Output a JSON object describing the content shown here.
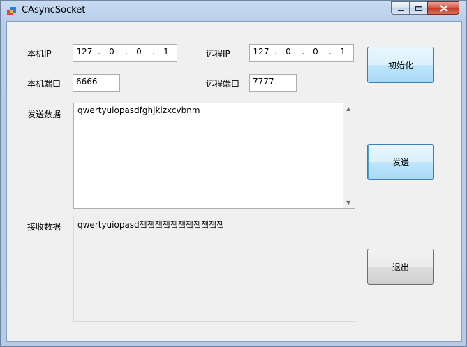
{
  "window": {
    "title": "CAsyncSocket"
  },
  "local": {
    "ip_label": "本机IP",
    "ip": [
      "127",
      "0",
      "0",
      "1"
    ],
    "port_label": "本机端口",
    "port": "6666"
  },
  "remote": {
    "ip_label": "远程IP",
    "ip": [
      "127",
      "0",
      "0",
      "1"
    ],
    "port_label": "远程端口",
    "port": "7777"
  },
  "send": {
    "label": "发送数据",
    "text": "qwertyuiopasdfghjklzxcvbnm"
  },
  "receive": {
    "label": "接收数据",
    "text": "qwertyuiopasd쳌쳌쳌쳌쳌쳌쳌쳌쳌쳌쳌"
  },
  "buttons": {
    "init": "初始化",
    "send": "发送",
    "exit": "退出"
  },
  "icons": {
    "app": "app-icon",
    "minimize": "minimize-icon",
    "maximize": "maximize-icon",
    "close": "close-icon"
  }
}
